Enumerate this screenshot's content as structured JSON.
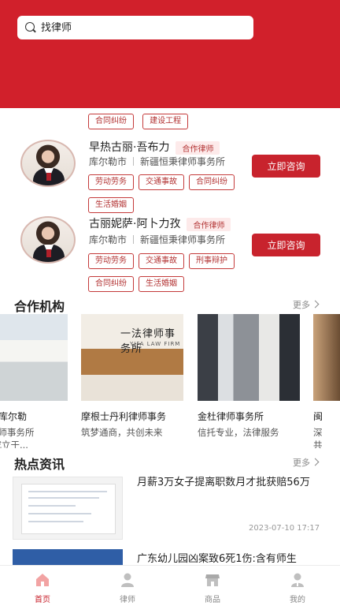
{
  "search": {
    "placeholder": "找律师"
  },
  "top_tags": [
    "合同纠纷",
    "建设工程"
  ],
  "lawyers": [
    {
      "name": "早热古丽·吾布力",
      "badge": "合作律师",
      "city": "库尔勒市",
      "firm": "新疆恒秉律师事务所",
      "tags": [
        "劳动劳务",
        "交通事故",
        "合同纠纷",
        "生活婚姻"
      ],
      "action": "立即咨询"
    },
    {
      "name": "古丽妮萨·阿卜力孜",
      "badge": "合作律师",
      "city": "库尔勒市",
      "firm": "新疆恒秉律师事务所",
      "tags": [
        "劳动劳务",
        "交通事故",
        "刑事辩护",
        "合同纠纷",
        "生活婚姻"
      ],
      "action": "立即咨询"
    }
  ],
  "partners_section": {
    "title": "合作机构",
    "more": "更多",
    "items": [
      {
        "name": "（库尔勒",
        "desc": "律师事务所\n)成立于..."
      },
      {
        "name": "摩根士丹利律师事务",
        "desc": "筑梦通商，共创未来"
      },
      {
        "name": "金杜律师事务所",
        "desc": "信托专业，法律服务"
      },
      {
        "name": "闽",
        "desc": "深\n共"
      }
    ],
    "sign_text": "一法律师事务所",
    "sign_sub": "YIFA LAW FIRM"
  },
  "news_section": {
    "title": "热点资讯",
    "more": "更多",
    "items": [
      {
        "title": "月薪3万女子提离职数月才批获赔56万",
        "date": "2023-07-10 17:17"
      },
      {
        "title": "广东幼儿园凶案致6死1伤:含有师生",
        "date": ""
      }
    ]
  },
  "tabbar": [
    {
      "label": "首页",
      "icon": "home-icon",
      "active": true
    },
    {
      "label": "律师",
      "icon": "lawyer-icon",
      "active": false
    },
    {
      "label": "商品",
      "icon": "shop-icon",
      "active": false
    },
    {
      "label": "我的",
      "icon": "profile-icon",
      "active": false
    }
  ],
  "colors": {
    "brand": "#d1202b",
    "button": "#c8232d",
    "tag_border": "#c43a3a"
  }
}
